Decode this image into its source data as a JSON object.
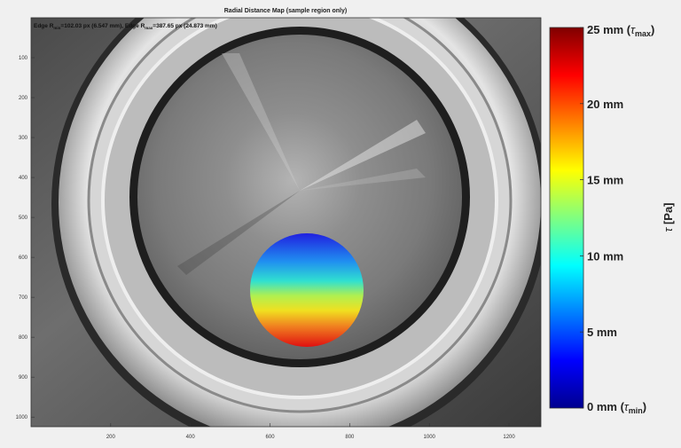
{
  "figure": {
    "title": "Radial Distance Map (sample region only)",
    "annotation_segments": [
      {
        "text": "Edge R",
        "kind": "normal"
      },
      {
        "text": "min",
        "kind": "sub"
      },
      {
        "text": "=102.03 px (6.547 mm), Edge R",
        "kind": "normal"
      },
      {
        "text": "max",
        "kind": "sub"
      },
      {
        "text": "=387.65 px (24.873 mm)",
        "kind": "normal"
      }
    ],
    "x_ticks": [
      "200",
      "400",
      "600",
      "800",
      "1000",
      "1200"
    ],
    "y_ticks": [
      "100",
      "200",
      "300",
      "400",
      "500",
      "600",
      "700",
      "800",
      "900",
      "1000"
    ]
  },
  "colorbar": {
    "label_main": "τ",
    "label_unit": " [Pa]",
    "ticks": [
      {
        "value": 25,
        "text": "25 mm (",
        "sym": "τ",
        "sub": "max",
        "close": ")"
      },
      {
        "value": 20,
        "text": "20 mm"
      },
      {
        "value": 15,
        "text": "15 mm"
      },
      {
        "value": 10,
        "text": "10 mm"
      },
      {
        "value": 5,
        "text": "5 mm"
      },
      {
        "value": 0,
        "text": "0 mm (",
        "sym": "τ",
        "sub": "min",
        "close": ")"
      }
    ],
    "range": [
      0,
      25
    ],
    "colors": [
      "#00008f",
      "#0000ff",
      "#0080ff",
      "#00ffff",
      "#80ff80",
      "#ffff00",
      "#ff8000",
      "#ff0000",
      "#800000"
    ]
  }
}
